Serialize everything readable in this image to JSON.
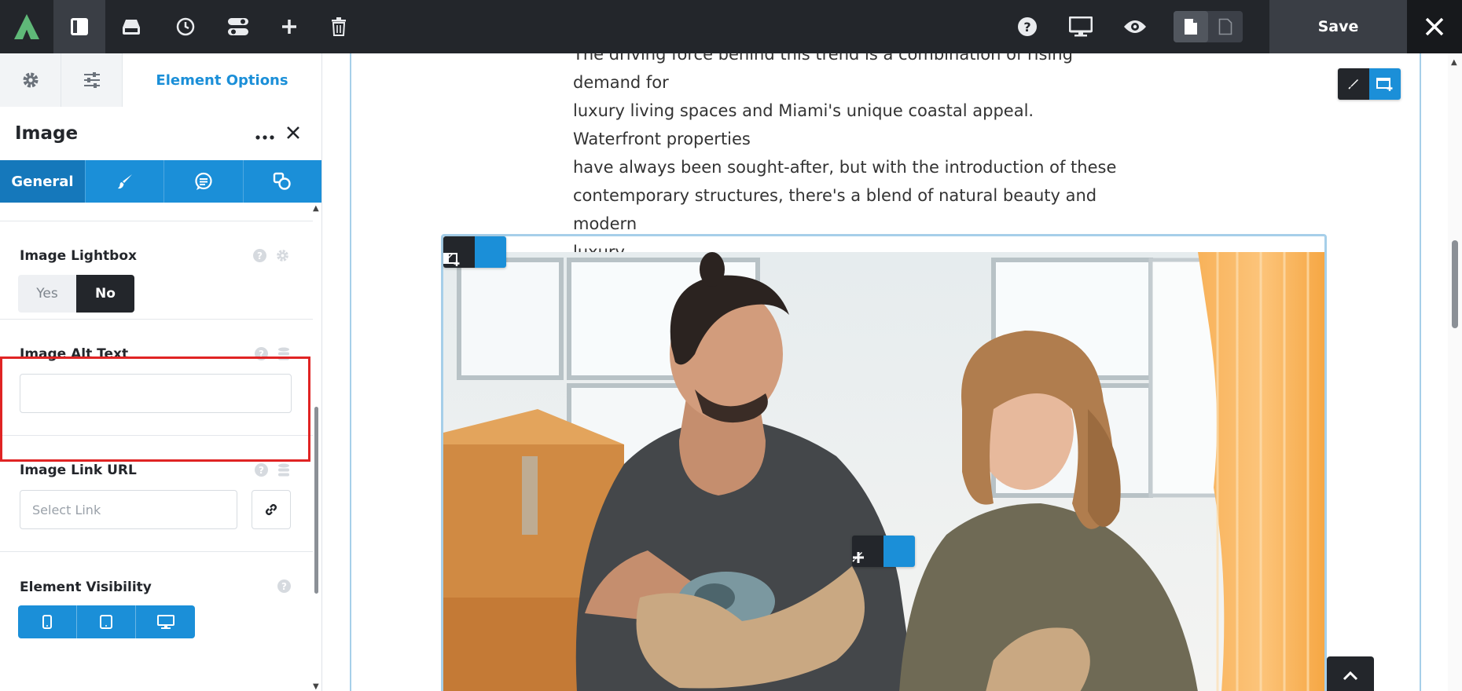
{
  "toolbar": {
    "save_label": "Save",
    "icons": [
      "logo-icon",
      "sidebar-toggle-icon",
      "library-icon",
      "history-icon",
      "toggles-icon",
      "add-icon",
      "trash-icon",
      "help-icon",
      "desktop-preview-icon",
      "eye-icon",
      "page-icon",
      "page-outline-icon",
      "close-icon"
    ]
  },
  "panel": {
    "tabs": {
      "options_label": "Element Options"
    },
    "element_title": "Image",
    "subtabs": {
      "general_label": "General"
    },
    "fields": {
      "lightbox": {
        "label": "Image Lightbox",
        "yes": "Yes",
        "no": "No",
        "selected": "No"
      },
      "alt_text": {
        "label": "Image Alt Text",
        "value": ""
      },
      "link_url": {
        "label": "Image Link URL",
        "placeholder": "Select Link"
      },
      "visibility": {
        "label": "Element Visibility"
      }
    },
    "help_glyph": "?"
  },
  "canvas": {
    "paragraph_lines": [
      "The driving force behind this trend is a combination of rising demand for",
      "luxury living spaces and Miami's unique coastal appeal. Waterfront properties",
      "have always been sought-after, but with the introduction of these",
      "contemporary structures, there's a blend of natural beauty and modern",
      "luxury."
    ]
  },
  "colors": {
    "accent": "#1b8fd8",
    "dark": "#23262b",
    "highlight": "#e02424"
  }
}
